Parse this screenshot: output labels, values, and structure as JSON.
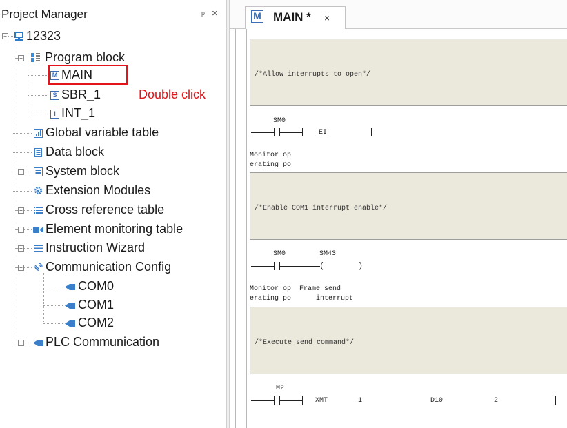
{
  "panel": {
    "title": "Project Manager",
    "pin_glyph": "ᵖ",
    "close_glyph": "×"
  },
  "tree": {
    "root": "12323",
    "program_block": "Program block",
    "main": "MAIN",
    "sbr1": "SBR_1",
    "int1": "INT_1",
    "global_variable_table": "Global variable table",
    "data_block": "Data block",
    "system_block": "System block",
    "extension_modules": "Extension Modules",
    "cross_reference_table": "Cross reference table",
    "element_monitoring_table": "Element monitoring table",
    "instruction_wizard": "Instruction Wizard",
    "communication_config": "Communication Config",
    "com0": "COM0",
    "com1": "COM1",
    "com2": "COM2",
    "plc_communication": "PLC Communication"
  },
  "annotation": {
    "text": "Double click",
    "color": "#e3151a"
  },
  "tab": {
    "icon_letter": "M",
    "label": "MAIN *",
    "close_glyph": "×"
  },
  "networks": [
    {
      "comment": "/*Allow interrupts to open*/",
      "contact": "SM0",
      "output": "EI",
      "label_line1": "Monitor op",
      "label_line2": "erating po"
    },
    {
      "comment": "/*Enable COM1 interrupt enable*/",
      "contact": "SM0",
      "coil": "SM43",
      "label_line1": "Monitor op",
      "label_line2": "erating po",
      "coil_label_line1": "Frame send",
      "coil_label_line2": "interrupt"
    },
    {
      "comment": "/*Execute send command*/",
      "contact": "M2",
      "instruction": "XMT",
      "arg1": "1",
      "arg2": "D10",
      "arg3": "2"
    }
  ],
  "colors": {
    "comment_bg": "#ebe8dc",
    "highlight": "#e3151a",
    "tab_icon": "#3a6fb5"
  }
}
